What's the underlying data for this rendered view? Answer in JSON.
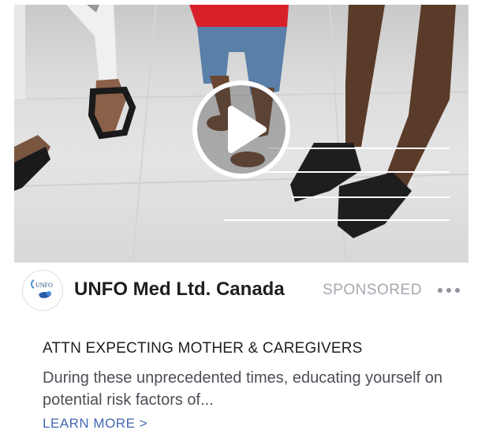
{
  "ad": {
    "page_name": "UNFO Med Ltd. Canada",
    "sponsored_label": "SPONSORED",
    "logo_text": "UNFO",
    "headline": "ATTN EXPECTING MOTHER & CAREGIVERS",
    "body": "During these unprecedented times, educating yourself on potential risk factors of...",
    "cta_label": "LEARN MORE >"
  },
  "icons": {
    "play": "play-icon",
    "more": "more-options-icon"
  },
  "colors": {
    "link": "#4267b2",
    "sponsored": "#a5a9b0",
    "text_dark": "#1c1e21",
    "text_body": "#4b4f56"
  }
}
